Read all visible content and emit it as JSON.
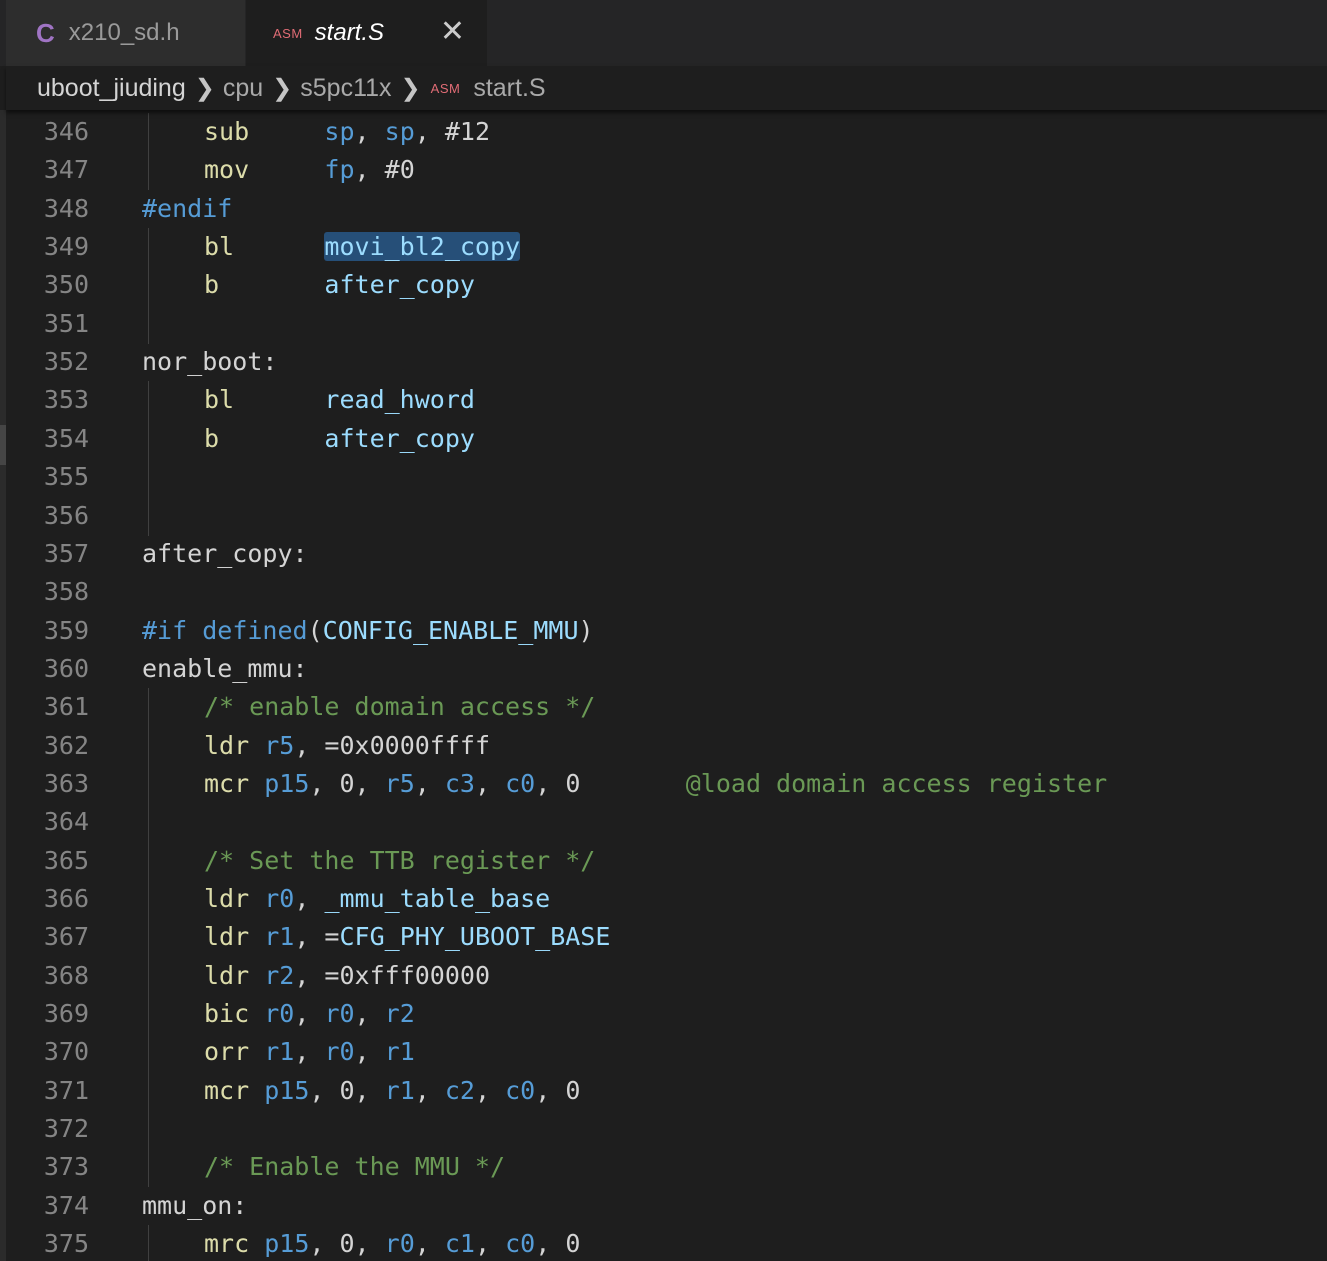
{
  "tabs": [
    {
      "icon": "C",
      "label": "x210_sd.h",
      "active": false
    },
    {
      "icon": "ASM",
      "label": "start.S",
      "active": true,
      "close": "✕"
    }
  ],
  "breadcrumb": {
    "items": [
      "uboot_jiuding",
      "cpu",
      "s5pc11x",
      "start.S"
    ],
    "file_icon": "ASM"
  },
  "colors": {
    "background": "#1e1e1e",
    "mnemonic": "#dcdcaa",
    "register": "#569cd6",
    "comment": "#6a9955",
    "selection": "#264f78"
  },
  "editor": {
    "lines": [
      {
        "num": "346",
        "tokens": [
          [
            "k",
            "sub"
          ],
          [
            "p",
            "     "
          ],
          [
            "r",
            "sp"
          ],
          [
            "p",
            ", "
          ],
          [
            "r",
            "sp"
          ],
          [
            "p",
            ", "
          ],
          [
            "n",
            "#12"
          ]
        ],
        "indent": 1
      },
      {
        "num": "347",
        "tokens": [
          [
            "k",
            "mov"
          ],
          [
            "p",
            "     "
          ],
          [
            "r",
            "fp"
          ],
          [
            "p",
            ", "
          ],
          [
            "n",
            "#0"
          ]
        ],
        "indent": 1
      },
      {
        "num": "348",
        "tokens": [
          [
            "pp",
            "#endif"
          ]
        ],
        "indent": 0
      },
      {
        "num": "349",
        "tokens": [
          [
            "k",
            "bl"
          ],
          [
            "p",
            "      "
          ],
          [
            "sel",
            "movi_bl2_copy"
          ]
        ],
        "indent": 1
      },
      {
        "num": "350",
        "tokens": [
          [
            "k",
            "b"
          ],
          [
            "p",
            "       "
          ],
          [
            "id",
            "after_copy"
          ]
        ],
        "indent": 1
      },
      {
        "num": "351",
        "tokens": [],
        "indent": 1
      },
      {
        "num": "352",
        "tokens": [
          [
            "lbl",
            "nor_boot:"
          ]
        ],
        "indent": 0
      },
      {
        "num": "353",
        "tokens": [
          [
            "k",
            "bl"
          ],
          [
            "p",
            "      "
          ],
          [
            "id",
            "read_hword"
          ]
        ],
        "indent": 1
      },
      {
        "num": "354",
        "tokens": [
          [
            "k",
            "b"
          ],
          [
            "p",
            "       "
          ],
          [
            "id",
            "after_copy"
          ]
        ],
        "indent": 1
      },
      {
        "num": "355",
        "tokens": [],
        "indent": 1
      },
      {
        "num": "356",
        "tokens": [],
        "indent": 1
      },
      {
        "num": "357",
        "tokens": [
          [
            "lbl",
            "after_copy:"
          ]
        ],
        "indent": 0
      },
      {
        "num": "358",
        "tokens": [],
        "indent": 0
      },
      {
        "num": "359",
        "tokens": [
          [
            "pp",
            "#if "
          ],
          [
            "r",
            "defined"
          ],
          [
            "p",
            "("
          ],
          [
            "id",
            "CONFIG_ENABLE_MMU"
          ],
          [
            "p",
            ")"
          ]
        ],
        "indent": 0
      },
      {
        "num": "360",
        "tokens": [
          [
            "lbl",
            "enable_mmu:"
          ]
        ],
        "indent": 0
      },
      {
        "num": "361",
        "tokens": [
          [
            "c",
            "/* enable domain access */"
          ]
        ],
        "indent": 1
      },
      {
        "num": "362",
        "tokens": [
          [
            "k",
            "ldr"
          ],
          [
            "p",
            " "
          ],
          [
            "r",
            "r5"
          ],
          [
            "p",
            ", ="
          ],
          [
            "n",
            "0x0000ffff"
          ]
        ],
        "indent": 1
      },
      {
        "num": "363",
        "tokens": [
          [
            "k",
            "mcr"
          ],
          [
            "p",
            " "
          ],
          [
            "r",
            "p15"
          ],
          [
            "p",
            ", "
          ],
          [
            "n",
            "0"
          ],
          [
            "p",
            ", "
          ],
          [
            "r",
            "r5"
          ],
          [
            "p",
            ", "
          ],
          [
            "r",
            "c3"
          ],
          [
            "p",
            ", "
          ],
          [
            "r",
            "c0"
          ],
          [
            "p",
            ", "
          ],
          [
            "n",
            "0"
          ],
          [
            "p",
            "       "
          ],
          [
            "c",
            "@load domain access register"
          ]
        ],
        "indent": 1
      },
      {
        "num": "364",
        "tokens": [],
        "indent": 1
      },
      {
        "num": "365",
        "tokens": [
          [
            "c",
            "/* Set the TTB register */"
          ]
        ],
        "indent": 1
      },
      {
        "num": "366",
        "tokens": [
          [
            "k",
            "ldr"
          ],
          [
            "p",
            " "
          ],
          [
            "r",
            "r0"
          ],
          [
            "p",
            ", "
          ],
          [
            "id",
            "_mmu_table_base"
          ]
        ],
        "indent": 1
      },
      {
        "num": "367",
        "tokens": [
          [
            "k",
            "ldr"
          ],
          [
            "p",
            " "
          ],
          [
            "r",
            "r1"
          ],
          [
            "p",
            ", ="
          ],
          [
            "id",
            "CFG_PHY_UBOOT_BASE"
          ]
        ],
        "indent": 1
      },
      {
        "num": "368",
        "tokens": [
          [
            "k",
            "ldr"
          ],
          [
            "p",
            " "
          ],
          [
            "r",
            "r2"
          ],
          [
            "p",
            ", ="
          ],
          [
            "n",
            "0xfff00000"
          ]
        ],
        "indent": 1
      },
      {
        "num": "369",
        "tokens": [
          [
            "k",
            "bic"
          ],
          [
            "p",
            " "
          ],
          [
            "r",
            "r0"
          ],
          [
            "p",
            ", "
          ],
          [
            "r",
            "r0"
          ],
          [
            "p",
            ", "
          ],
          [
            "r",
            "r2"
          ]
        ],
        "indent": 1
      },
      {
        "num": "370",
        "tokens": [
          [
            "k",
            "orr"
          ],
          [
            "p",
            " "
          ],
          [
            "r",
            "r1"
          ],
          [
            "p",
            ", "
          ],
          [
            "r",
            "r0"
          ],
          [
            "p",
            ", "
          ],
          [
            "r",
            "r1"
          ]
        ],
        "indent": 1
      },
      {
        "num": "371",
        "tokens": [
          [
            "k",
            "mcr"
          ],
          [
            "p",
            " "
          ],
          [
            "r",
            "p15"
          ],
          [
            "p",
            ", "
          ],
          [
            "n",
            "0"
          ],
          [
            "p",
            ", "
          ],
          [
            "r",
            "r1"
          ],
          [
            "p",
            ", "
          ],
          [
            "r",
            "c2"
          ],
          [
            "p",
            ", "
          ],
          [
            "r",
            "c0"
          ],
          [
            "p",
            ", "
          ],
          [
            "n",
            "0"
          ]
        ],
        "indent": 1
      },
      {
        "num": "372",
        "tokens": [],
        "indent": 1
      },
      {
        "num": "373",
        "tokens": [
          [
            "c",
            "/* Enable the MMU */"
          ]
        ],
        "indent": 1
      },
      {
        "num": "374",
        "tokens": [
          [
            "lbl",
            "mmu_on:"
          ]
        ],
        "indent": 0
      },
      {
        "num": "375",
        "tokens": [
          [
            "k",
            "mrc"
          ],
          [
            "p",
            " "
          ],
          [
            "r",
            "p15"
          ],
          [
            "p",
            ", "
          ],
          [
            "n",
            "0"
          ],
          [
            "p",
            ", "
          ],
          [
            "r",
            "r0"
          ],
          [
            "p",
            ", "
          ],
          [
            "r",
            "c1"
          ],
          [
            "p",
            ", "
          ],
          [
            "r",
            "c0"
          ],
          [
            "p",
            ", "
          ],
          [
            "n",
            "0"
          ]
        ],
        "indent": 1
      }
    ]
  }
}
